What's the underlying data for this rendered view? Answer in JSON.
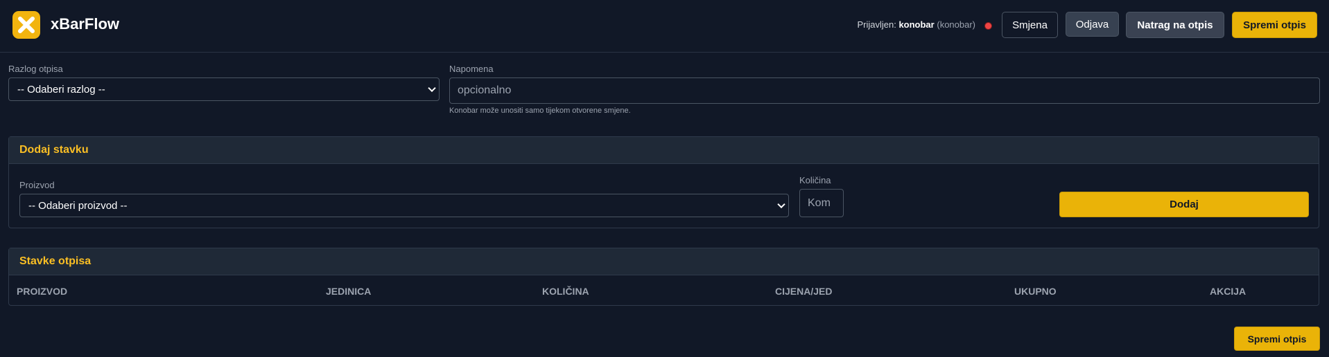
{
  "header": {
    "app_title": "xBarFlow",
    "logged_in_label": "Prijavljen:",
    "username": "konobar",
    "role": "(konobar)",
    "smjena_label": "Smjena",
    "odjava_label": "Odjava",
    "natrag_label": "Natrag na otpis",
    "spremi_label": "Spremi otpis"
  },
  "form": {
    "razlog_label": "Razlog otpisa",
    "razlog_value": "-- Odaberi razlog --",
    "napomena_label": "Napomena",
    "napomena_placeholder": "opcionalno",
    "hint": "Konobar može unositi samo tijekom otvorene smjene."
  },
  "add_item": {
    "title": "Dodaj stavku",
    "proizvod_label": "Proizvod",
    "proizvod_value": "-- Odaberi proizvod --",
    "kolicina_label": "Količina",
    "kolicina_placeholder": "Kom",
    "dodaj_label": "Dodaj"
  },
  "items": {
    "title": "Stavke otpisa",
    "columns": [
      "PROIZVOD",
      "JEDINICA",
      "KOLIČINA",
      "CIJENA/JED",
      "UKUPNO",
      "AKCIJA"
    ]
  },
  "footer": {
    "spremi_label": "Spremi otpis"
  },
  "colors": {
    "accent": "#eab308",
    "background": "#111827",
    "panel_header": "#1f2937",
    "status_dot": "#ef4444"
  }
}
